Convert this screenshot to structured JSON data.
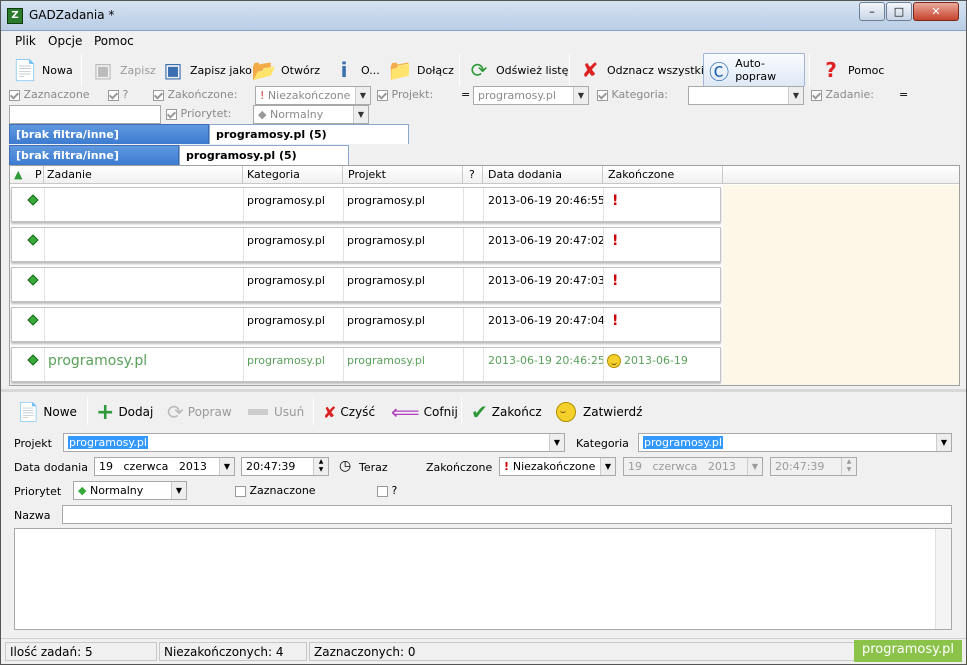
{
  "window": {
    "title": "GADZadania *",
    "icon": "gz-app-icon",
    "min": "–",
    "max": "□",
    "close": "✕"
  },
  "menu": [
    "Plik",
    "Opcje",
    "Pomoc"
  ],
  "toolbar": {
    "nowa": "Nowa",
    "zapisz": "Zapisz",
    "zapisz_jako": "Zapisz jako",
    "otworz": "Otwórz",
    "o": "O...",
    "dolacz": "Dołącz",
    "odswiez": "Odśwież listę",
    "odznacz": "Odznacz wszystkie",
    "autopopraw": "Auto-popraw",
    "pomoc": "Pomoc"
  },
  "filters": {
    "zaznaczone": "Zaznaczone",
    "q": "?",
    "zakonczone": "Zakończone:",
    "zakonczone_value": "Niezakończone",
    "projekt": "Projekt:",
    "eq1": "=",
    "projekt_value": "programosy.pl",
    "kategoria": "Kategoria:",
    "kategoria_value": "",
    "zadanie": "Zadanie:",
    "eq2": "=",
    "priorytet": "Priorytet:",
    "priorytet_value": "Normalny"
  },
  "tabs1": [
    "[brak filtra/inne]",
    "programosy.pl (5)"
  ],
  "tabs2": [
    "[brak filtra/inne]",
    "programosy.pl (5)"
  ],
  "grid": {
    "headers": [
      "P",
      "Zadanie",
      "Kategoria",
      "Projekt",
      "?",
      "Data dodania",
      "Zakończone"
    ],
    "rows": [
      {
        "zadanie": "",
        "kategoria": "programosy.pl",
        "projekt": "programosy.pl",
        "data": "2013-06-19 20:46:55",
        "zak": "!",
        "done": false
      },
      {
        "zadanie": "",
        "kategoria": "programosy.pl",
        "projekt": "programosy.pl",
        "data": "2013-06-19 20:47:02",
        "zak": "!",
        "done": false
      },
      {
        "zadanie": "",
        "kategoria": "programosy.pl",
        "projekt": "programosy.pl",
        "data": "2013-06-19 20:47:03",
        "zak": "!",
        "done": false
      },
      {
        "zadanie": "",
        "kategoria": "programosy.pl",
        "projekt": "programosy.pl",
        "data": "2013-06-19 20:47:04",
        "zak": "!",
        "done": false
      },
      {
        "zadanie": "programosy.pl",
        "kategoria": "programosy.pl",
        "projekt": "programosy.pl",
        "data": "2013-06-19 20:46:25",
        "zak": "2013-06-19",
        "done": true
      }
    ]
  },
  "editor": {
    "nowe": "Nowe",
    "dodaj": "Dodaj",
    "popraw": "Popraw",
    "usun": "Usuń",
    "czysc": "Czyść",
    "cofnij": "Cofnij",
    "zakoncz": "Zakończ",
    "zatwierdz": "Zatwierdź",
    "projekt_lbl": "Projekt",
    "projekt_val": "programosy.pl",
    "kategoria_lbl": "Kategoria",
    "kategoria_val": "programosy.pl",
    "data_lbl": "Data dodania",
    "day": "19",
    "month": "czerwca",
    "year": "2013",
    "time": "20:47:39",
    "teraz": "Teraz",
    "zak_lbl": "Zakończone",
    "zak_val": "Niezakończone",
    "day2": "19",
    "month2": "czerwca",
    "year2": "2013",
    "time2": "20:47:39",
    "priorytet_lbl": "Priorytet",
    "priorytet_val": "Normalny",
    "zaznaczone": "Zaznaczone",
    "q": "?",
    "nazwa_lbl": "Nazwa",
    "nazwa_val": ""
  },
  "status": {
    "ilosc": "Ilość zadań: 5",
    "niezak": "Niezakończonych: 4",
    "zazn": "Zaznaczonych: 0",
    "brand": "programosy.pl"
  }
}
